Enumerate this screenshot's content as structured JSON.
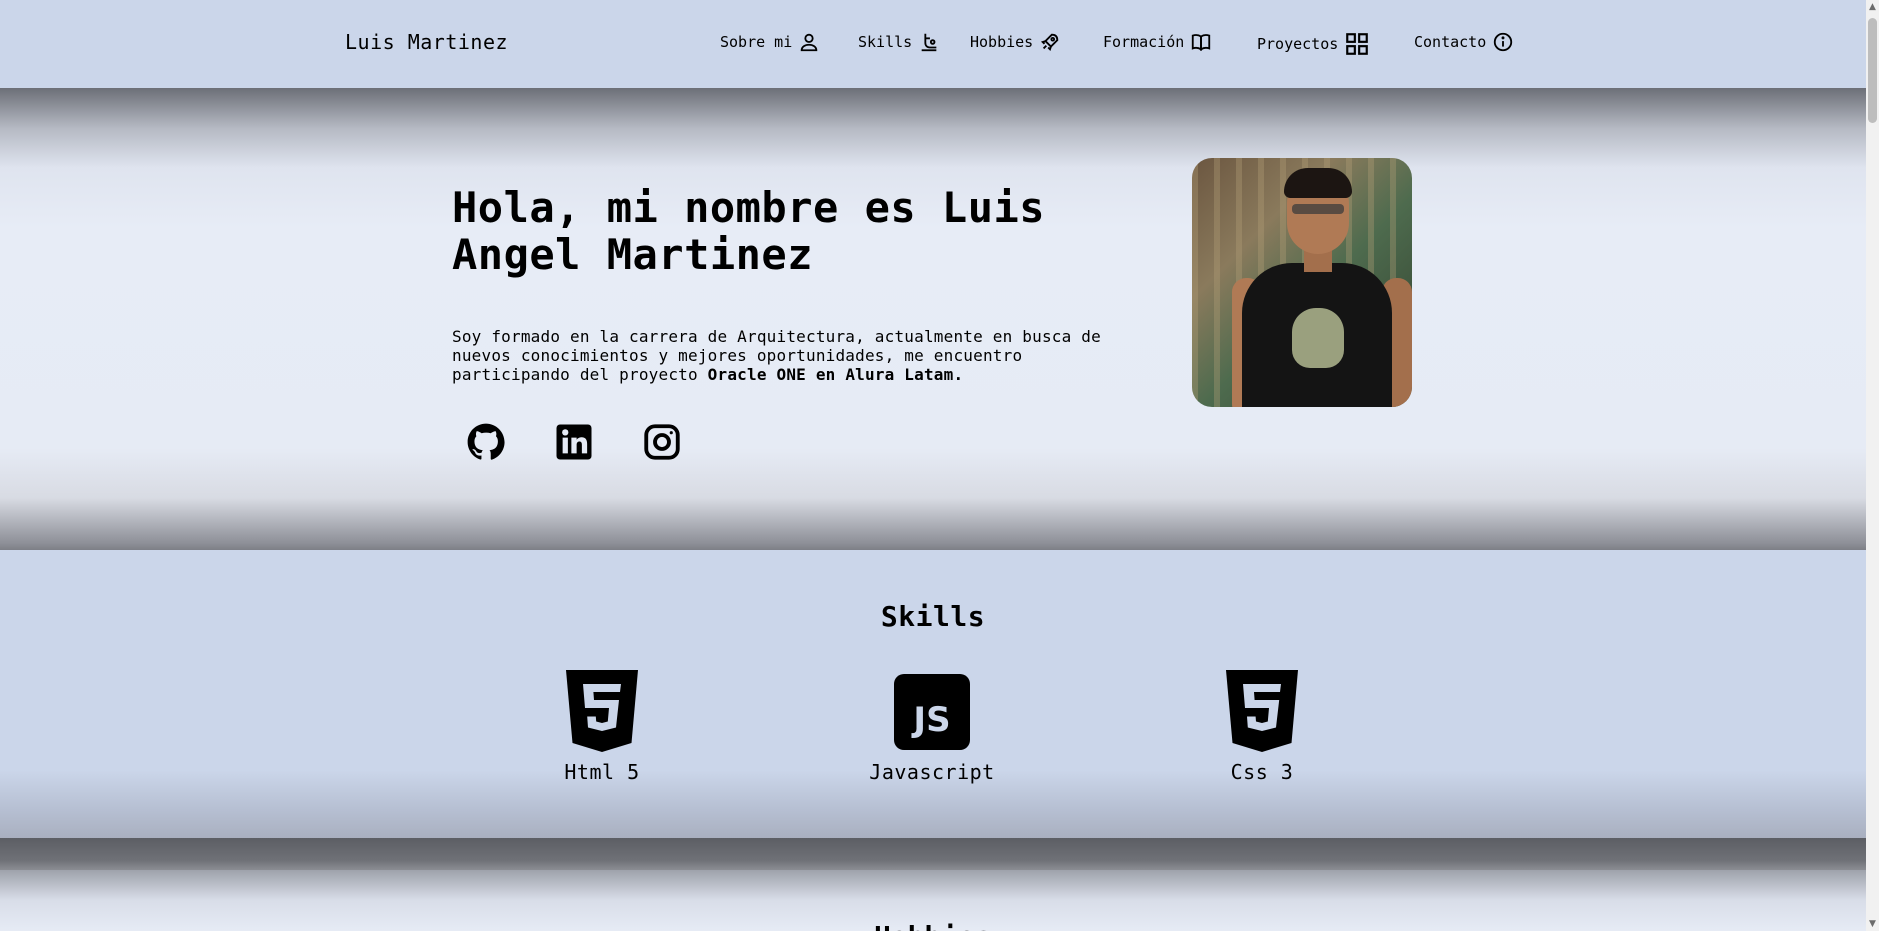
{
  "header": {
    "brand": "Luis Martinez",
    "nav": [
      {
        "label": "Sobre mi",
        "icon": "user-icon"
      },
      {
        "label": "Skills",
        "icon": "skills-icon"
      },
      {
        "label": "Hobbies",
        "icon": "rocket-icon"
      },
      {
        "label": "Formación",
        "icon": "book-icon"
      },
      {
        "label": "Proyectos",
        "icon": "grid-icon"
      },
      {
        "label": "Contacto",
        "icon": "info-icon"
      }
    ]
  },
  "hero": {
    "title": "Hola, mi nombre es Luis Angel Martinez",
    "description": "Soy formado en la carrera de Arquitectura, actualmente en busca de nuevos conocimientos y mejores oportunidades, me encuentro participando del proyecto ",
    "description_strong": "Oracle ONE en Alura Latam.",
    "socials": [
      "github-icon",
      "linkedin-icon",
      "instagram-icon"
    ]
  },
  "skills": {
    "title": "Skills",
    "items": [
      {
        "label": "Html 5",
        "icon": "html5-icon"
      },
      {
        "label": "Javascript",
        "icon": "javascript-icon"
      },
      {
        "label": "Css 3",
        "icon": "css3-icon"
      }
    ]
  },
  "hobbies": {
    "title": "Hobbies"
  },
  "colors": {
    "header_bg": "#cbd6ea",
    "hero_bg": "#e6ebf5",
    "text": "#000000"
  }
}
